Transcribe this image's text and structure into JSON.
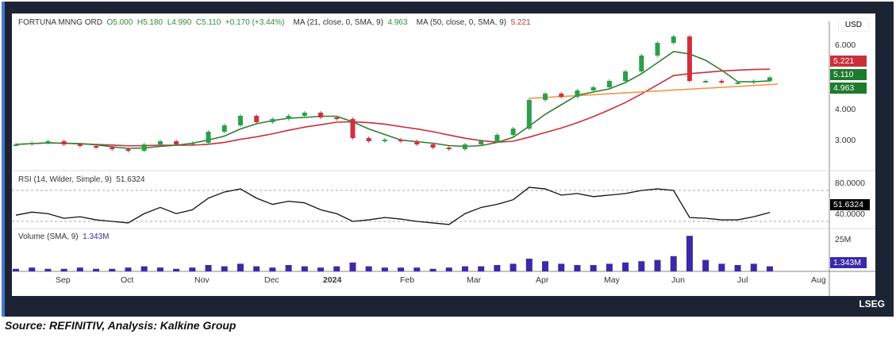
{
  "header": {
    "symbol": "FORTUNA MNNG ORD",
    "open": "O5.000",
    "high": "H5.180",
    "low": "L4.990",
    "close": "C5.110",
    "change": "+0.170 (+3.44%)",
    "ma21_label": "MA (21, close, 0, SMA, 9)",
    "ma21_value": "4.963",
    "ma50_label": "MA (50, close, 0, SMA, 9)",
    "ma50_value": "5.221"
  },
  "currency": "USD",
  "rsi_label": "RSI (14, Wilder, Simple, 9)",
  "rsi_value": "51.6324",
  "volume_label": "Volume (SMA, 9)",
  "volume_value": "1.343M",
  "branding": "LSEG",
  "source": "Source: REFINITIV, Analysis: Kalkine Group",
  "colors": {
    "up": "#2e9e4a",
    "down": "#d0303c",
    "ma21": "#2e7d32",
    "ma50": "#c8303c",
    "trend": "#f0903c",
    "volume": "#3a2aa8",
    "rsi": "#111111"
  },
  "chart_data": {
    "type": "candlestick",
    "price_axis": {
      "ticks": [
        "6.000",
        "4.000",
        "3.000"
      ],
      "tick_values": [
        6,
        4,
        3
      ],
      "ylim": [
        2.4,
        6.8
      ]
    },
    "rsi_axis": {
      "ticks": [
        "80.0000",
        "40.0000"
      ],
      "tick_values": [
        80,
        40
      ]
    },
    "volume_axis": {
      "ticks": [
        "25M"
      ]
    },
    "price_tags": [
      {
        "label": "5.221",
        "color": "#c8303c"
      },
      {
        "label": "5.110",
        "color": "#1e7a2e"
      },
      {
        "label": "4.963",
        "color": "#1e7a2e"
      }
    ],
    "months": [
      "Sep",
      "Oct",
      "Nov",
      "Dec",
      "2024",
      "Feb",
      "Mar",
      "Apr",
      "May",
      "Jun",
      "Jul",
      "Aug"
    ],
    "closes": [
      3.0,
      3.05,
      3.1,
      3.0,
      2.95,
      2.9,
      2.85,
      2.8,
      3.0,
      3.1,
      3.0,
      3.05,
      3.4,
      3.6,
      3.9,
      3.7,
      3.8,
      3.9,
      4.0,
      3.85,
      3.8,
      3.2,
      3.1,
      3.15,
      3.1,
      3.0,
      2.9,
      2.85,
      3.0,
      3.1,
      3.3,
      3.5,
      4.4,
      4.6,
      4.5,
      4.7,
      4.8,
      5.0,
      5.3,
      5.8,
      6.2,
      6.4,
      5.0,
      5.0,
      4.95,
      4.95,
      5.0,
      5.11
    ],
    "rsi": [
      48,
      52,
      50,
      44,
      46,
      42,
      40,
      38,
      50,
      58,
      50,
      55,
      70,
      78,
      82,
      70,
      62,
      66,
      64,
      55,
      50,
      40,
      42,
      45,
      43,
      40,
      38,
      36,
      50,
      58,
      62,
      68,
      84,
      82,
      74,
      76,
      72,
      74,
      76,
      80,
      82,
      80,
      45,
      44,
      42,
      42,
      46,
      51.6
    ],
    "volume_m": [
      2,
      3,
      2,
      2,
      3,
      2,
      2,
      3,
      4,
      3,
      2,
      3,
      5,
      4,
      6,
      4,
      3,
      5,
      4,
      3,
      4,
      7,
      4,
      3,
      3,
      3,
      2,
      3,
      4,
      4,
      5,
      6,
      10,
      8,
      6,
      5,
      5,
      6,
      7,
      8,
      9,
      12,
      28,
      9,
      6,
      5,
      6,
      4
    ]
  }
}
